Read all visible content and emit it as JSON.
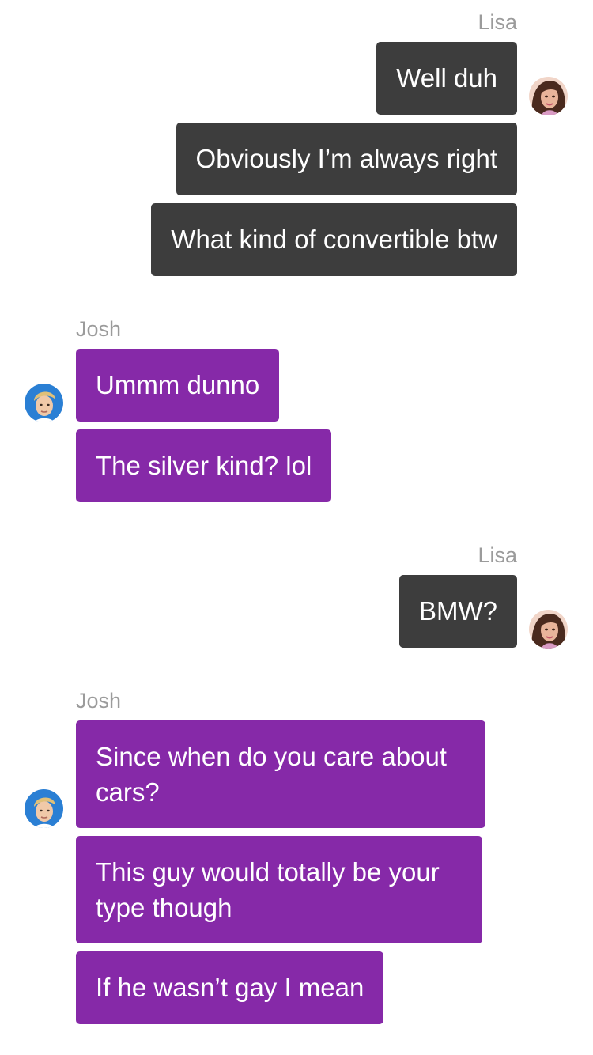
{
  "colors": {
    "outgoing_bubble": "#3d3d3d",
    "incoming_bubble": "#8629a8",
    "sender_name": "#9b9b9b",
    "background": "#ffffff"
  },
  "groups": [
    {
      "sender": "Lisa",
      "side": "right",
      "avatar_icon": "lisa-avatar-icon",
      "messages": [
        "Well duh",
        "Obviously I’m always right",
        "What kind of convertible btw"
      ]
    },
    {
      "sender": "Josh",
      "side": "left",
      "avatar_icon": "josh-avatar-icon",
      "messages": [
        "Ummm dunno",
        "The silver kind? lol"
      ]
    },
    {
      "sender": "Lisa",
      "side": "right",
      "avatar_icon": "lisa-avatar-icon",
      "messages": [
        "BMW?"
      ]
    },
    {
      "sender": "Josh",
      "side": "left",
      "avatar_icon": "josh-avatar-icon",
      "messages": [
        "Since when do you care about cars?",
        "This guy would totally be your type though",
        "If he wasn’t gay I mean"
      ]
    }
  ]
}
